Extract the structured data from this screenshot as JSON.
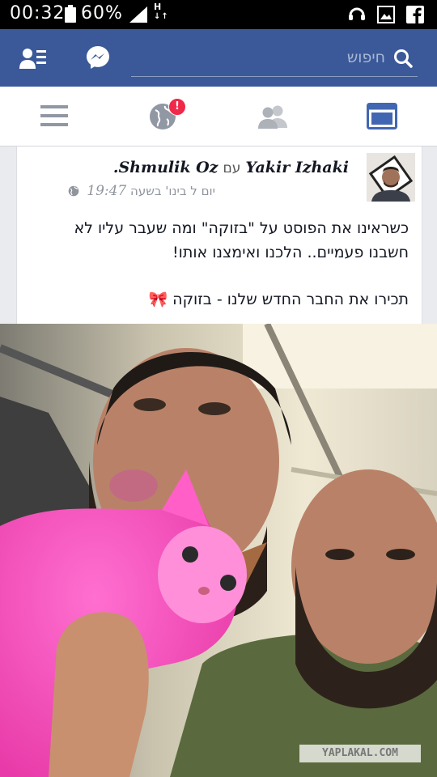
{
  "status_bar": {
    "time": "00:32",
    "battery": "60%",
    "network": "H"
  },
  "header": {
    "search_placeholder": "חיפוש",
    "icons": [
      "friend-requests-icon",
      "messenger-icon",
      "search-icon"
    ]
  },
  "navbar": {
    "icons": [
      "menu-icon",
      "notifications-globe-icon",
      "friends-icon",
      "news-feed-icon"
    ],
    "notification_badge": "!"
  },
  "post": {
    "author": "Yakir Izhaki",
    "with_word": "עם",
    "tagged": "Shmulik Oz",
    "date": "יום ל בינו' בשעה",
    "clock": "19:47",
    "line1": "כשראינו את הפוסט על \"בזוקה\" ומה שעבר עליו לא",
    "line2": "חשבנו פעמיים.. הלכנו ואימצנו אותו!",
    "line3": "תכירו את החבר החדש שלנו - בזוקה 🎀"
  },
  "watermark": "YAPLAKAL.COM",
  "colors": {
    "brand": "#3b5998",
    "badge": "#f02849"
  }
}
